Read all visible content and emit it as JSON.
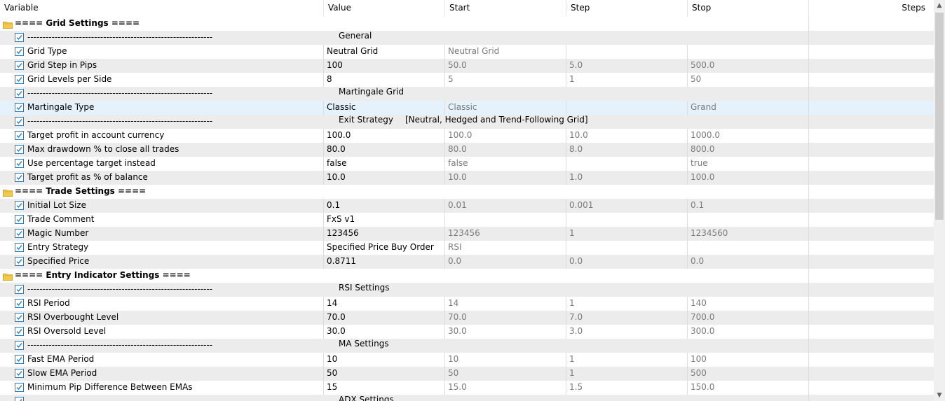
{
  "columns": {
    "variable": "Variable",
    "value": "Value",
    "start": "Start",
    "step": "Step",
    "stop": "Stop",
    "steps": "Steps"
  },
  "rows": [
    {
      "kind": "group",
      "label": "==== Grid Settings ===="
    },
    {
      "kind": "section",
      "variable": "-------------------------------------------------------------",
      "label": "General"
    },
    {
      "kind": "param",
      "variable": "Grid Type",
      "value": "Neutral Grid",
      "start": "Neutral Grid",
      "step": "",
      "stop": ""
    },
    {
      "kind": "param",
      "variable": "Grid Step in Pips",
      "value": "100",
      "start": "50.0",
      "step": "5.0",
      "stop": "500.0"
    },
    {
      "kind": "param",
      "variable": "Grid Levels per Side",
      "value": "8",
      "start": "5",
      "step": "1",
      "stop": "50"
    },
    {
      "kind": "section",
      "variable": "-------------------------------------------------------------",
      "label": "Martingale Grid"
    },
    {
      "kind": "param",
      "variable": "Martingale Type",
      "value": "Classic",
      "start": "Classic",
      "step": "",
      "stop": "Grand",
      "selected": true
    },
    {
      "kind": "section",
      "variable": "-------------------------------------------------------------",
      "label": "Exit Strategy",
      "extra": "[Neutral, Hedged and Trend-Following Grid]"
    },
    {
      "kind": "param",
      "variable": "Target profit in account currency",
      "value": "100.0",
      "start": "100.0",
      "step": "10.0",
      "stop": "1000.0"
    },
    {
      "kind": "param",
      "variable": "Max drawdown % to close all trades",
      "value": "80.0",
      "start": "80.0",
      "step": "8.0",
      "stop": "800.0"
    },
    {
      "kind": "param",
      "variable": "Use percentage target instead",
      "value": "false",
      "start": "false",
      "step": "",
      "stop": "true"
    },
    {
      "kind": "param",
      "variable": "Target profit as % of balance",
      "value": "10.0",
      "start": "10.0",
      "step": "1.0",
      "stop": "100.0"
    },
    {
      "kind": "group",
      "label": "==== Trade Settings ===="
    },
    {
      "kind": "param",
      "variable": "Initial Lot Size",
      "value": "0.1",
      "start": "0.01",
      "step": "0.001",
      "stop": "0.1"
    },
    {
      "kind": "param",
      "variable": "Trade Comment",
      "value": "FxS v1",
      "start": "",
      "step": "",
      "stop": ""
    },
    {
      "kind": "param",
      "variable": "Magic Number",
      "value": "123456",
      "start": "123456",
      "step": "1",
      "stop": "1234560"
    },
    {
      "kind": "param",
      "variable": "Entry Strategy",
      "value": "Specified Price Buy Order",
      "start": "RSI",
      "step": "",
      "stop": ""
    },
    {
      "kind": "param",
      "variable": "Specified Price",
      "value": "0.8711",
      "start": "0.0",
      "step": "0.0",
      "stop": "0.0"
    },
    {
      "kind": "group",
      "label": "==== Entry Indicator Settings ===="
    },
    {
      "kind": "section",
      "variable": "-------------------------------------------------------------",
      "label": "RSI Settings"
    },
    {
      "kind": "param",
      "variable": "RSI Period",
      "value": "14",
      "start": "14",
      "step": "1",
      "stop": "140"
    },
    {
      "kind": "param",
      "variable": "RSI Overbought Level",
      "value": "70.0",
      "start": "70.0",
      "step": "7.0",
      "stop": "700.0"
    },
    {
      "kind": "param",
      "variable": "RSI Oversold Level",
      "value": "30.0",
      "start": "30.0",
      "step": "3.0",
      "stop": "300.0"
    },
    {
      "kind": "section",
      "variable": "-------------------------------------------------------------",
      "label": "MA Settings"
    },
    {
      "kind": "param",
      "variable": "Fast EMA Period",
      "value": "10",
      "start": "10",
      "step": "1",
      "stop": "100"
    },
    {
      "kind": "param",
      "variable": "Slow EMA Period",
      "value": "50",
      "start": "50",
      "step": "1",
      "stop": "500"
    },
    {
      "kind": "param",
      "variable": "Minimum Pip Difference Between EMAs",
      "value": "15",
      "start": "15.0",
      "step": "1.5",
      "stop": "150.0"
    },
    {
      "kind": "section",
      "variable": "-------------------------------------------------------------",
      "label": "ADX Settings"
    }
  ],
  "colors": {
    "checkbox_border": "#1c7ccf",
    "row_alt": "#ececec",
    "row_selected": "#e5f1fb",
    "folder": "#f2c94c",
    "disabled_text": "#7a7a7a"
  },
  "icons": {
    "group": "folder-icon",
    "param": "checkbox-checked-icon"
  }
}
